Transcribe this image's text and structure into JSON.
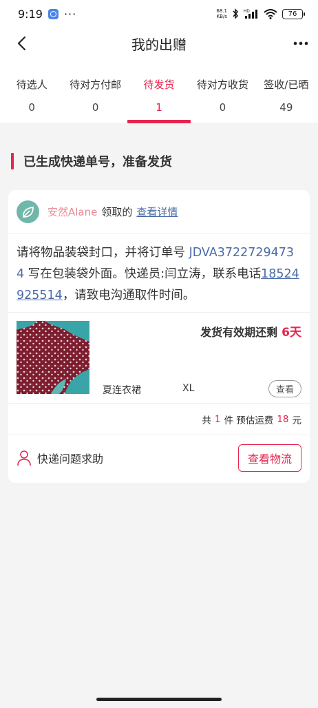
{
  "status_bar": {
    "time": "9:19",
    "dots": "···",
    "net_speed_value": "68.1",
    "net_speed_unit": "KB/s",
    "battery": "76"
  },
  "nav": {
    "title": "我的出赠"
  },
  "tabs": [
    {
      "label": "待选人",
      "count": "0"
    },
    {
      "label": "待对方付邮",
      "count": "0"
    },
    {
      "label": "待发货",
      "count": "1",
      "active": true
    },
    {
      "label": "待对方收货",
      "count": "0"
    },
    {
      "label": "签收/已晒",
      "count": "49"
    }
  ],
  "section": {
    "heading": "已生成快递单号，准备发货"
  },
  "order": {
    "receiver_name": "安然Alane",
    "claim_text": "领取的",
    "detail_link": "查看详情",
    "instruction_part1": "请将物品装袋封口，并将订单号 ",
    "order_number": "JDVA37227294734",
    "instruction_part2": " 写在包装袋外面。快递员:闫立涛，联系电话",
    "phone": "18524925514",
    "instruction_part3": "，请致电沟通取件时间。",
    "deadline_text": "发货有效期还剩",
    "deadline_days": "6天",
    "item_name": "夏连衣裙",
    "item_size": "XL",
    "view_button": "查看",
    "summary_prefix": "共",
    "item_count": "1",
    "summary_mid": "件 预估运费",
    "shipping_fee": "18",
    "summary_unit": "元",
    "help_label": "快递问题求助",
    "logistics_button": "查看物流"
  },
  "colors": {
    "accent": "#e8254f",
    "link": "#4a6ba8",
    "receiver": "#e88a95"
  },
  "icons": {
    "back": "chevron-left-icon",
    "more": "more-horizontal-icon",
    "help": "person-icon"
  }
}
